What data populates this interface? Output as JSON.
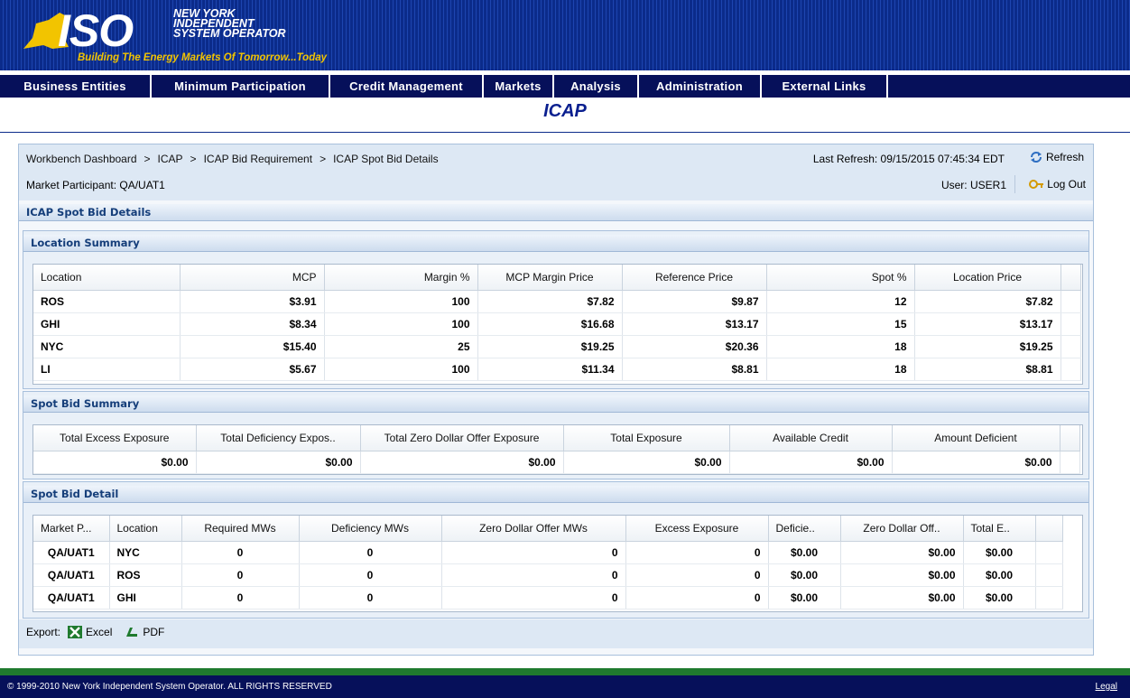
{
  "header": {
    "logo_text": "ISO",
    "org_line1": "NEW YORK",
    "org_line2": "INDEPENDENT",
    "org_line3": "SYSTEM OPERATOR",
    "tagline": "Building The Energy Markets Of Tomorrow...Today"
  },
  "nav": [
    "Business Entities",
    "Minimum Participation",
    "Credit Management",
    "Markets",
    "Analysis",
    "Administration",
    "External Links"
  ],
  "page_title": "ICAP",
  "breadcrumb": [
    "Workbench Dashboard",
    "ICAP",
    "ICAP Bid Requirement",
    "ICAP Spot Bid Details"
  ],
  "breadcrumb_sep": ">",
  "market_participant": "Market Participant: QA/UAT1",
  "last_refresh": "Last Refresh: 09/15/2015 07:45:34 EDT",
  "refresh_label": "Refresh",
  "user_label": "User: USER1",
  "logout_label": "Log Out",
  "panel_title": "ICAP Spot Bid Details",
  "location_summary": {
    "title": "Location Summary",
    "columns": [
      "Location",
      "MCP",
      "Margin %",
      "MCP Margin Price",
      "Reference Price",
      "Spot %",
      "Location Price"
    ],
    "rows": [
      [
        "ROS",
        "$3.91",
        "100",
        "$7.82",
        "$9.87",
        "12",
        "$7.82"
      ],
      [
        "GHI",
        "$8.34",
        "100",
        "$16.68",
        "$13.17",
        "15",
        "$13.17"
      ],
      [
        "NYC",
        "$15.40",
        "25",
        "$19.25",
        "$20.36",
        "18",
        "$19.25"
      ],
      [
        "LI",
        "$5.67",
        "100",
        "$11.34",
        "$8.81",
        "18",
        "$8.81"
      ]
    ]
  },
  "spot_bid_summary": {
    "title": "Spot Bid Summary",
    "columns": [
      "Total Excess Exposure",
      "Total Deficiency Expos..",
      "Total Zero Dollar Offer Exposure",
      "Total Exposure",
      "Available Credit",
      "Amount Deficient"
    ],
    "rows": [
      [
        "$0.00",
        "$0.00",
        "$0.00",
        "$0.00",
        "$0.00",
        "$0.00"
      ]
    ]
  },
  "spot_bid_detail": {
    "title": "Spot Bid Detail",
    "columns": [
      "Market P...",
      "Location",
      "Required MWs",
      "Deficiency MWs",
      "Zero Dollar Offer MWs",
      "Excess Exposure",
      "Deficie..",
      "Zero Dollar Off..",
      "Total E.."
    ],
    "rows": [
      [
        "QA/UAT1",
        "NYC",
        "0",
        "0",
        "0",
        "0",
        "$0.00",
        "$0.00",
        "$0.00"
      ],
      [
        "QA/UAT1",
        "ROS",
        "0",
        "0",
        "0",
        "0",
        "$0.00",
        "$0.00",
        "$0.00"
      ],
      [
        "QA/UAT1",
        "GHI",
        "0",
        "0",
        "0",
        "0",
        "$0.00",
        "$0.00",
        "$0.00"
      ]
    ]
  },
  "export": {
    "label": "Export:",
    "excel": "Excel",
    "pdf": "PDF"
  },
  "footer": {
    "copyright": "© 1999-2010 New York Independent System Operator. ALL RIGHTS RESERVED",
    "legal": "Legal"
  },
  "colors": {
    "header_blue": "#0b2b8a",
    "nav_navy": "#06105a",
    "title_blue": "#0a1f8f",
    "footer_green": "#1f7a2e",
    "tagline_yellow": "#f2c400"
  }
}
